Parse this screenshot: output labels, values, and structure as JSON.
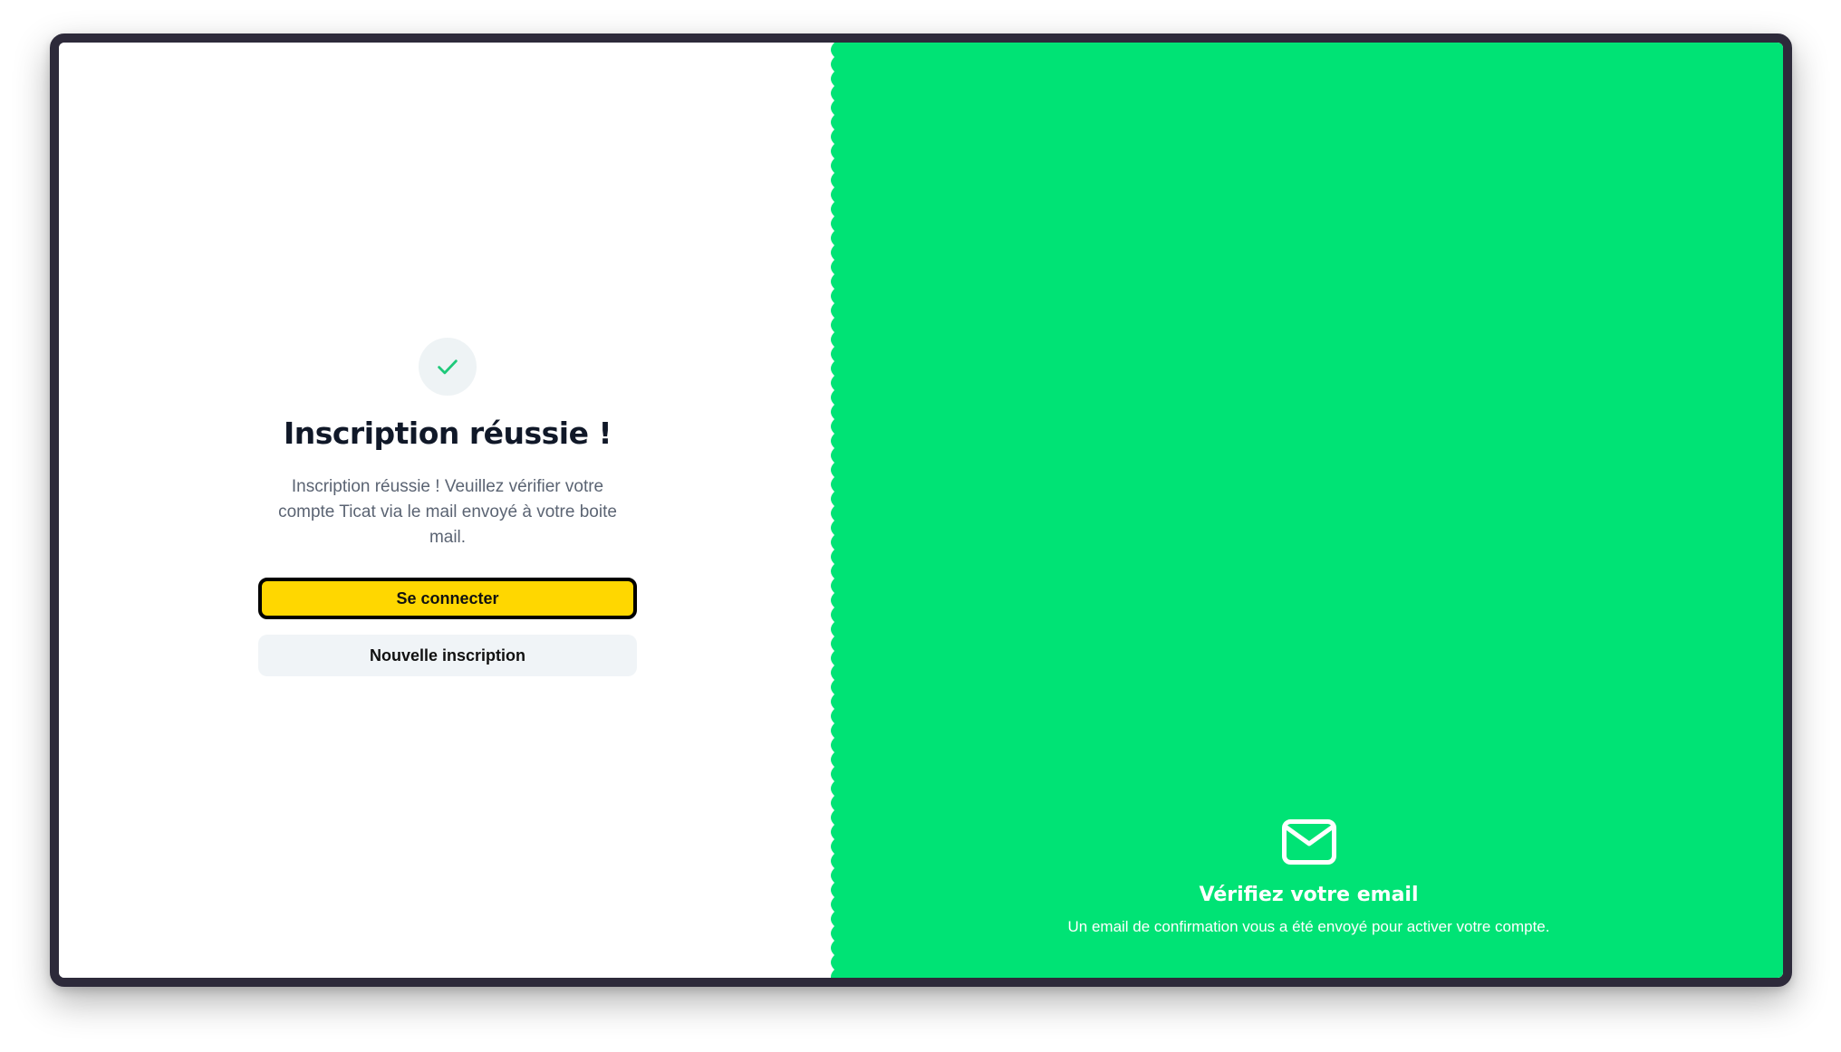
{
  "success": {
    "icon": "check-icon",
    "title": "Inscription réussie !",
    "message": "Inscription réussie ! Veuillez vérifier votre compte Ticat via le mail envoyé à votre boite mail.",
    "login_button": "Se connecter",
    "new_signup_button": "Nouvelle inscription"
  },
  "info_panel": {
    "icon": "mail-icon",
    "title": "Vérifiez votre email",
    "text": "Un email de confirmation vous a été envoyé pour activer votre compte."
  },
  "colors": {
    "accent_green": "#00e375",
    "primary_button": "#ffd700",
    "secondary_button": "#f0f4f7",
    "frame": "#2d2a3a"
  }
}
